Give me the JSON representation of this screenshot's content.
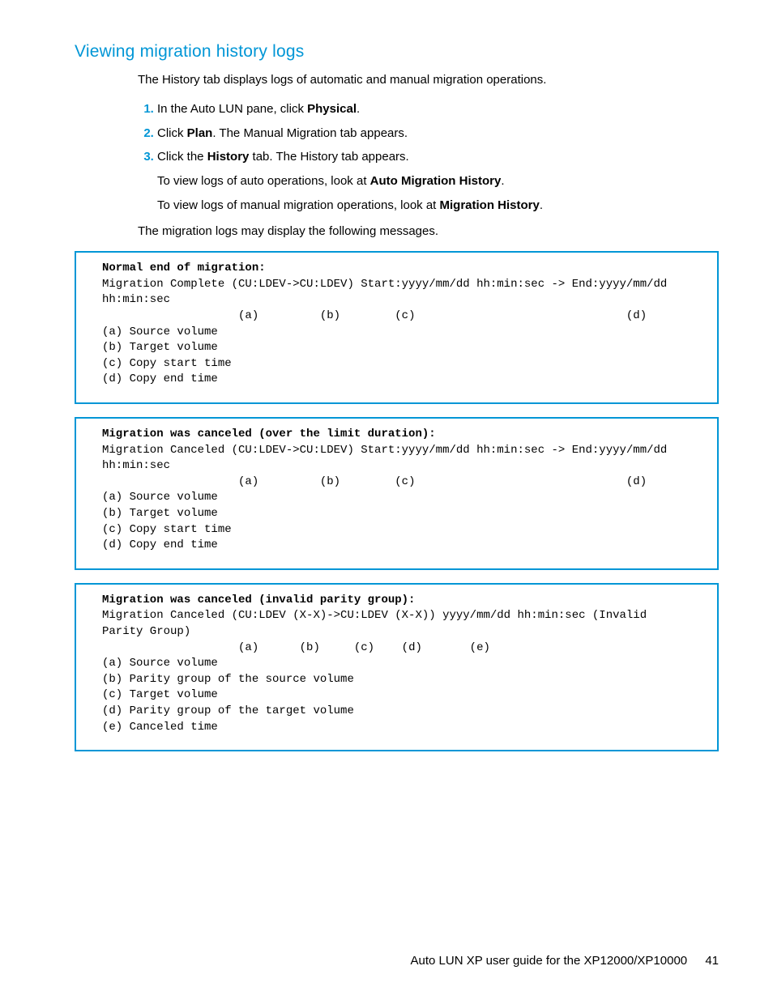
{
  "heading": "Viewing migration history logs",
  "intro": "The History tab displays logs of automatic and manual migration operations.",
  "steps": {
    "s1_pre": "In the Auto LUN pane, click ",
    "s1_bold": "Physical",
    "s1_post": ".",
    "s2_pre": "Click ",
    "s2_bold": "Plan",
    "s2_post": ". The Manual Migration tab appears.",
    "s3_pre": "Click the ",
    "s3_bold": "History",
    "s3_post": " tab. The History tab appears.",
    "s3p1_pre": "To view logs of auto operations, look at ",
    "s3p1_bold": "Auto Migration History",
    "s3p1_post": ".",
    "s3p2_pre": "To view logs of manual migration operations, look at ",
    "s3p2_bold": "Migration History",
    "s3p2_post": "."
  },
  "outro": "The migration logs may display the following messages.",
  "box1": {
    "title": "Normal end of migration:",
    "body": "Migration Complete (CU:LDEV->CU:LDEV) Start:yyyy/mm/dd hh:min:sec -> End:yyyy/mm/dd hh:min:sec\n                    (a)         (b)        (c)                               (d)\n(a) Source volume\n(b) Target volume\n(c) Copy start time\n(d) Copy end time"
  },
  "box2": {
    "title": "Migration was canceled (over the limit duration):",
    "body": "Migration Canceled (CU:LDEV->CU:LDEV) Start:yyyy/mm/dd hh:min:sec -> End:yyyy/mm/dd hh:min:sec\n                    (a)         (b)        (c)                               (d)\n(a) Source volume\n(b) Target volume\n(c) Copy start time\n(d) Copy end time"
  },
  "box3": {
    "title": "Migration was canceled (invalid parity group):",
    "body": "Migration Canceled (CU:LDEV (X-X)->CU:LDEV (X-X)) yyyy/mm/dd hh:min:sec (Invalid Parity Group)\n                    (a)      (b)     (c)    (d)       (e)\n(a) Source volume\n(b) Parity group of the source volume\n(c) Target volume\n(d) Parity group of the target volume\n(e) Canceled time"
  },
  "footer": {
    "title": "Auto LUN XP user guide for the XP12000/XP10000",
    "page": "41"
  }
}
